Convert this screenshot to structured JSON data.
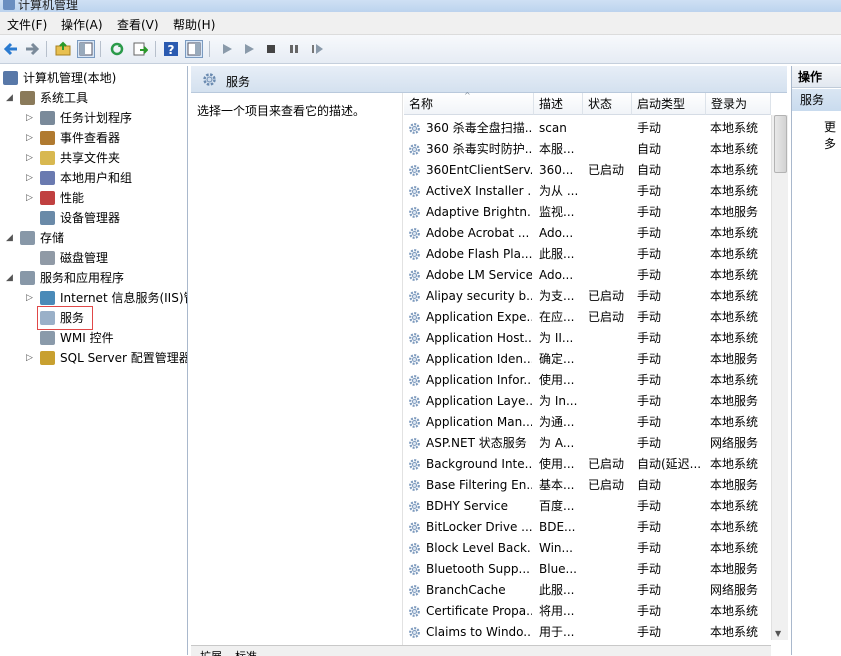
{
  "window": {
    "title": "计算机管理"
  },
  "menu": [
    "文件(F)",
    "操作(A)",
    "查看(V)",
    "帮助(H)"
  ],
  "tree": [
    {
      "label": "计算机管理(本地)",
      "indent": 0,
      "arrow": "",
      "icon": "computer-icon",
      "color": "#5878a8"
    },
    {
      "label": "系统工具",
      "indent": 1,
      "arrow": "◢",
      "icon": "tools-icon",
      "color": "#8a7a5a"
    },
    {
      "label": "任务计划程序",
      "indent": 2,
      "arrow": "▷",
      "icon": "clock-icon",
      "color": "#7a8a9a"
    },
    {
      "label": "事件查看器",
      "indent": 2,
      "arrow": "▷",
      "icon": "event-viewer-icon",
      "color": "#b07a30"
    },
    {
      "label": "共享文件夹",
      "indent": 2,
      "arrow": "▷",
      "icon": "shared-folder-icon",
      "color": "#d8b850"
    },
    {
      "label": "本地用户和组",
      "indent": 2,
      "arrow": "▷",
      "icon": "users-icon",
      "color": "#6a7ab0"
    },
    {
      "label": "性能",
      "indent": 2,
      "arrow": "▷",
      "icon": "performance-icon",
      "color": "#c04040"
    },
    {
      "label": "设备管理器",
      "indent": 2,
      "arrow": "",
      "icon": "device-manager-icon",
      "color": "#6a8aa8"
    },
    {
      "label": "存储",
      "indent": 1,
      "arrow": "◢",
      "icon": "storage-icon",
      "color": "#8898a8"
    },
    {
      "label": "磁盘管理",
      "indent": 2,
      "arrow": "",
      "icon": "disk-icon",
      "color": "#909aa6"
    },
    {
      "label": "服务和应用程序",
      "indent": 1,
      "arrow": "◢",
      "icon": "services-apps-icon",
      "color": "#8898a8"
    },
    {
      "label": "Internet 信息服务(IIS)管",
      "indent": 2,
      "arrow": "▷",
      "icon": "iis-icon",
      "color": "#4a8ab8"
    },
    {
      "label": "服务",
      "indent": 2,
      "arrow": "",
      "icon": "services-gear-icon",
      "color": "#9ab0c8",
      "selected": true
    },
    {
      "label": "WMI 控件",
      "indent": 2,
      "arrow": "",
      "icon": "wmi-icon",
      "color": "#8a9aaa"
    },
    {
      "label": "SQL Server 配置管理器",
      "indent": 2,
      "arrow": "▷",
      "icon": "sql-server-icon",
      "color": "#c8a030"
    }
  ],
  "panel": {
    "title": "服务",
    "description": "选择一个项目来查看它的描述。"
  },
  "columns": [
    "名称",
    "描述",
    "状态",
    "启动类型",
    "登录为"
  ],
  "services": [
    {
      "name": "360 杀毒全盘扫描...",
      "desc": "scan",
      "status": "",
      "startup": "手动",
      "logon": "本地系统"
    },
    {
      "name": "360 杀毒实时防护...",
      "desc": "本服...",
      "status": "",
      "startup": "自动",
      "logon": "本地系统"
    },
    {
      "name": "360EntClientServ...",
      "desc": "360...",
      "status": "已启动",
      "startup": "自动",
      "logon": "本地系统"
    },
    {
      "name": "ActiveX Installer ...",
      "desc": "为从 ...",
      "status": "",
      "startup": "手动",
      "logon": "本地系统"
    },
    {
      "name": "Adaptive Brightn...",
      "desc": "监视...",
      "status": "",
      "startup": "手动",
      "logon": "本地服务"
    },
    {
      "name": "Adobe Acrobat ...",
      "desc": "Ado...",
      "status": "",
      "startup": "手动",
      "logon": "本地系统"
    },
    {
      "name": "Adobe Flash Pla...",
      "desc": "此服...",
      "status": "",
      "startup": "手动",
      "logon": "本地系统"
    },
    {
      "name": "Adobe LM Service",
      "desc": "Ado...",
      "status": "",
      "startup": "手动",
      "logon": "本地系统"
    },
    {
      "name": "Alipay security b...",
      "desc": "为支...",
      "status": "已启动",
      "startup": "手动",
      "logon": "本地系统"
    },
    {
      "name": "Application Expe...",
      "desc": "在应...",
      "status": "已启动",
      "startup": "手动",
      "logon": "本地系统"
    },
    {
      "name": "Application Host...",
      "desc": "为 II...",
      "status": "",
      "startup": "手动",
      "logon": "本地系统"
    },
    {
      "name": "Application Iden...",
      "desc": "确定...",
      "status": "",
      "startup": "手动",
      "logon": "本地服务"
    },
    {
      "name": "Application Infor...",
      "desc": "使用...",
      "status": "",
      "startup": "手动",
      "logon": "本地系统"
    },
    {
      "name": "Application Laye...",
      "desc": "为 In...",
      "status": "",
      "startup": "手动",
      "logon": "本地服务"
    },
    {
      "name": "Application Man...",
      "desc": "为通...",
      "status": "",
      "startup": "手动",
      "logon": "本地系统"
    },
    {
      "name": "ASP.NET 状态服务",
      "desc": "为 A...",
      "status": "",
      "startup": "手动",
      "logon": "网络服务"
    },
    {
      "name": "Background Inte...",
      "desc": "使用...",
      "status": "已启动",
      "startup": "自动(延迟...",
      "logon": "本地系统"
    },
    {
      "name": "Base Filtering En...",
      "desc": "基本...",
      "status": "已启动",
      "startup": "自动",
      "logon": "本地服务"
    },
    {
      "name": "BDHY Service",
      "desc": "百度...",
      "status": "",
      "startup": "手动",
      "logon": "本地系统"
    },
    {
      "name": "BitLocker Drive ...",
      "desc": "BDE...",
      "status": "",
      "startup": "手动",
      "logon": "本地系统"
    },
    {
      "name": "Block Level Back...",
      "desc": "Win...",
      "status": "",
      "startup": "手动",
      "logon": "本地系统"
    },
    {
      "name": "Bluetooth Supp...",
      "desc": "Blue...",
      "status": "",
      "startup": "手动",
      "logon": "本地服务"
    },
    {
      "name": "BranchCache",
      "desc": "此服...",
      "status": "",
      "startup": "手动",
      "logon": "网络服务"
    },
    {
      "name": "Certificate Propa...",
      "desc": "将用...",
      "status": "",
      "startup": "手动",
      "logon": "本地系统"
    },
    {
      "name": "Claims to Windo...",
      "desc": "用于...",
      "status": "",
      "startup": "手动",
      "logon": "本地系统"
    }
  ],
  "actions": {
    "header": "操作",
    "section": "服务",
    "more": "更多"
  },
  "bottom_tabs": [
    "扩展",
    "标准"
  ]
}
